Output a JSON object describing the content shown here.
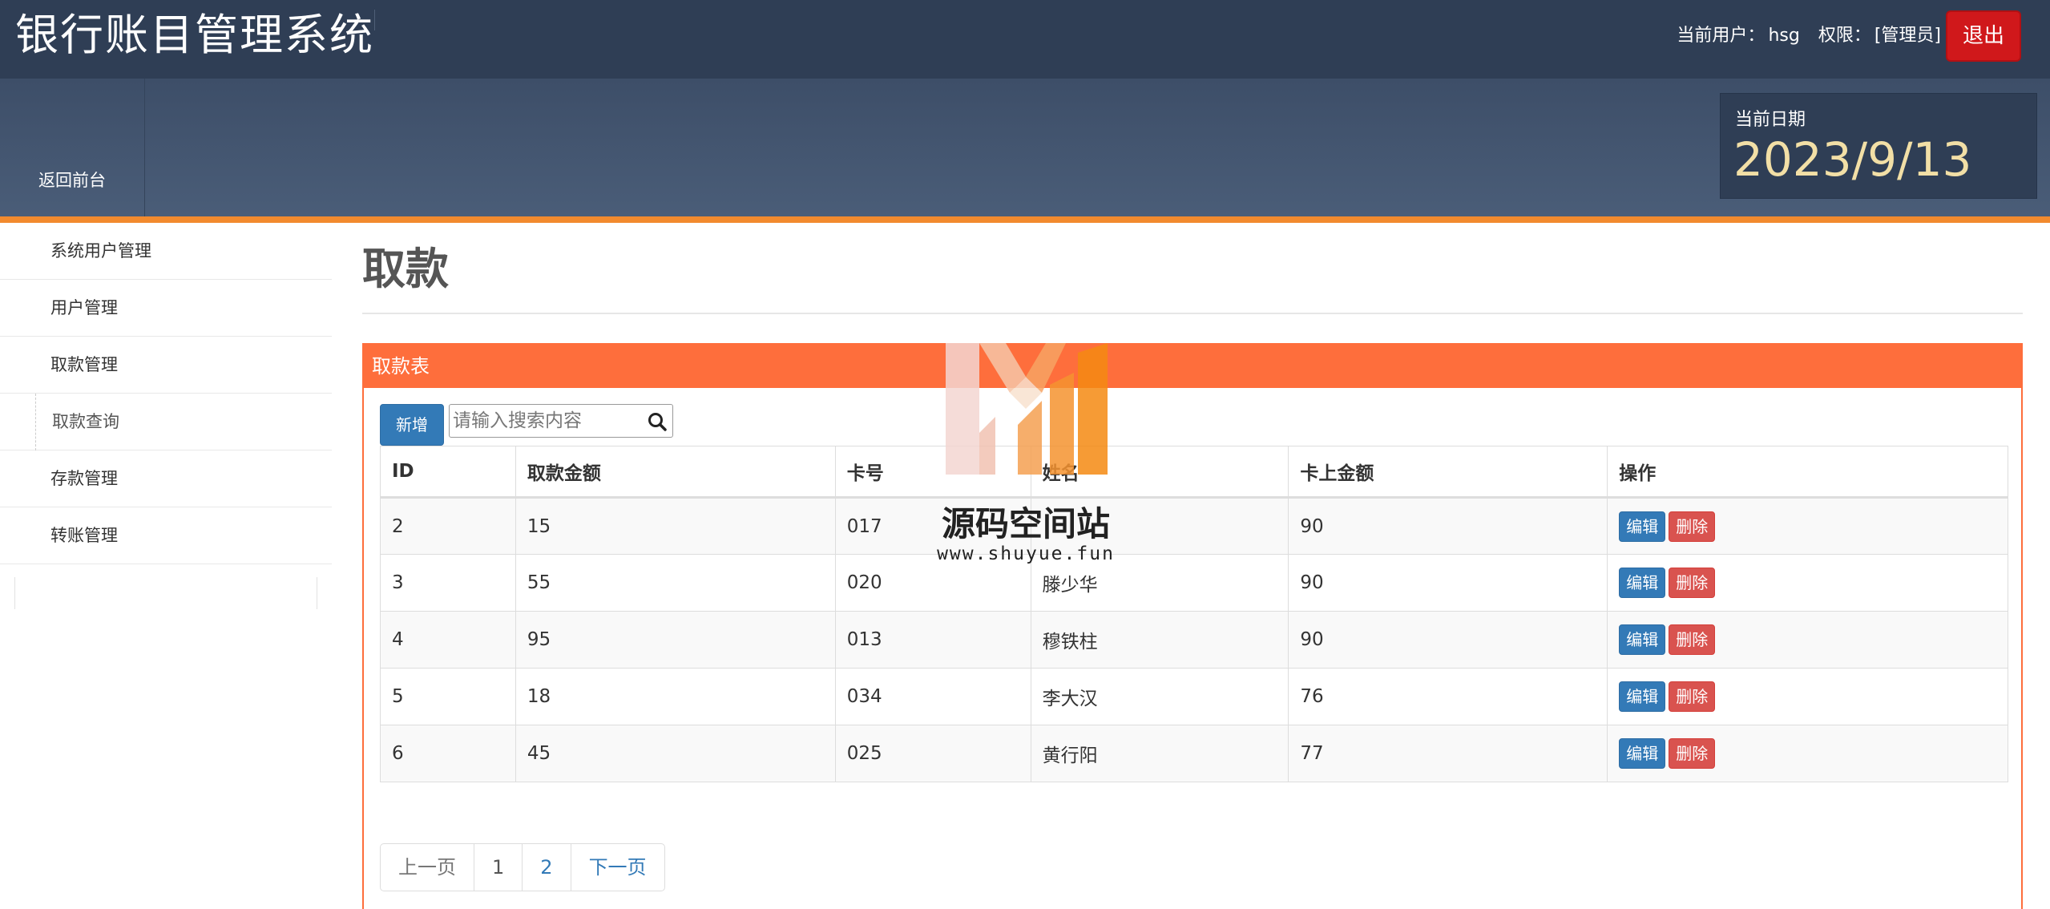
{
  "header": {
    "app_title": "银行账目管理系统",
    "user_label": "当前用户：",
    "user_name": "hsg",
    "role_label": "权限：",
    "role_value": "[管理员]",
    "logout_label": "退出"
  },
  "subbar": {
    "back_label": "返回前台",
    "date_label": "当前日期",
    "date_value": "2023/9/13"
  },
  "sidebar": {
    "items": [
      {
        "label": "系统用户管理"
      },
      {
        "label": "用户管理"
      },
      {
        "label": "取款管理"
      },
      {
        "label": "取款查询"
      },
      {
        "label": "存款管理"
      },
      {
        "label": "转账管理"
      }
    ]
  },
  "main": {
    "page_title": "取款",
    "panel_title": "取款表",
    "add_label": "新增",
    "search_placeholder": "请输入搜索内容",
    "search_icon": "search-icon",
    "columns": [
      "ID",
      "取款金额",
      "卡号",
      "姓名",
      "卡上金额",
      "操作"
    ],
    "rows": [
      {
        "id": "2",
        "amount": "15",
        "card": "017",
        "name": "",
        "balance": "90"
      },
      {
        "id": "3",
        "amount": "55",
        "card": "020",
        "name": "滕少华",
        "balance": "90"
      },
      {
        "id": "4",
        "amount": "95",
        "card": "013",
        "name": "穆铁柱",
        "balance": "90"
      },
      {
        "id": "5",
        "amount": "18",
        "card": "034",
        "name": "李大汉",
        "balance": "76"
      },
      {
        "id": "6",
        "amount": "45",
        "card": "025",
        "name": "黄行阳",
        "balance": "77"
      }
    ],
    "edit_label": "编辑",
    "delete_label": "删除",
    "pagination": {
      "prev": "上一页",
      "pages": [
        "1",
        "2"
      ],
      "next": "下一页"
    }
  },
  "watermark": {
    "text": "源码空间站",
    "url": "www.shuyue.fun"
  },
  "colors": {
    "topbar": "#2f3e55",
    "accent_orange": "#fe6e3c",
    "primary_blue": "#337ab7",
    "danger_red": "#d9534f",
    "logout_red": "#d0181b",
    "date_gold": "#f2dfa6"
  }
}
